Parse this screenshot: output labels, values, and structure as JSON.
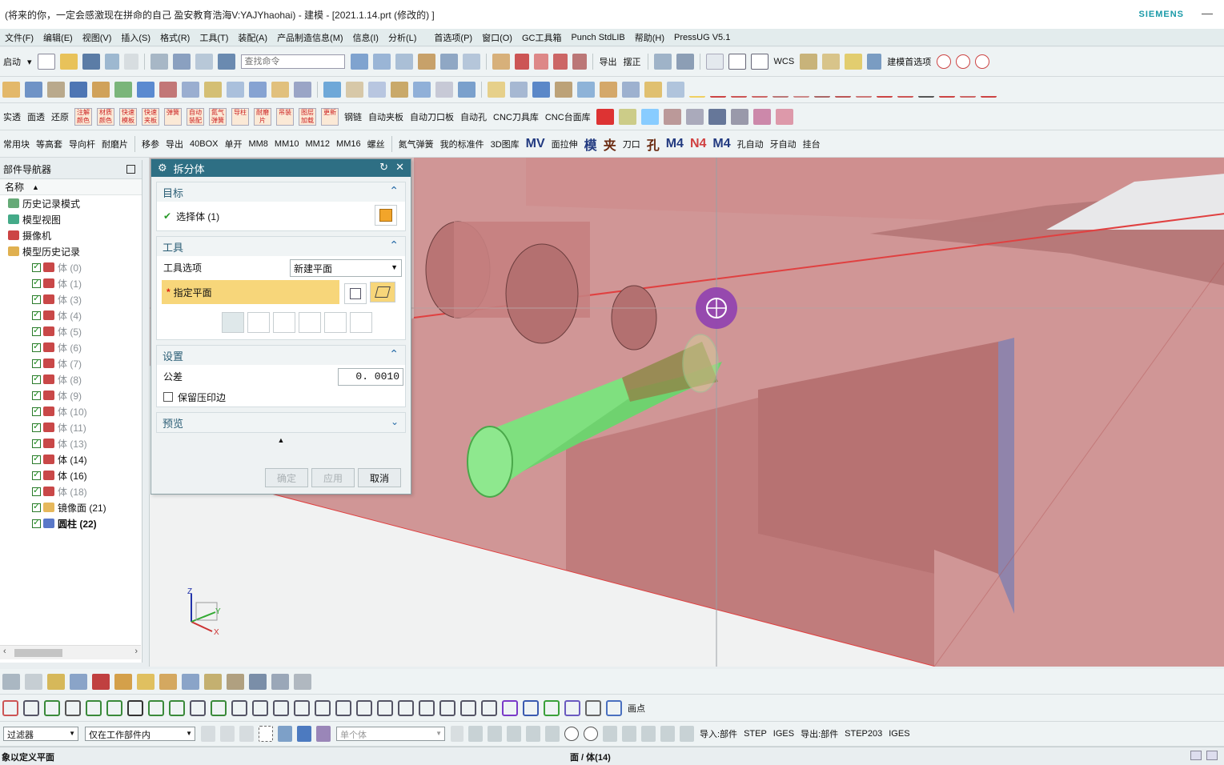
{
  "window": {
    "title": "(将来的你，一定会感激现在拼命的自己 盈安教育浩海V:YAJYhaohai) - 建模 - [2021.1.14.prt  (修改的) ]",
    "brand": "SIEMENS",
    "minimize": "—"
  },
  "menu": [
    "文件(F)",
    "编辑(E)",
    "视图(V)",
    "插入(S)",
    "格式(R)",
    "工具(T)",
    "装配(A)",
    "产品制造信息(M)",
    "信息(I)",
    "分析(L)",
    "首选项(P)",
    "窗口(O)",
    "GC工具箱",
    "Punch StdLIB",
    "帮助(H)",
    "PressUG V5.1"
  ],
  "toolbar1": {
    "start": "启动",
    "search_placeholder": "查找命令",
    "export": "导出",
    "align": "摆正",
    "wcs": "WCS",
    "model_pref": "建模首选项"
  },
  "toolbar3": [
    "实透",
    "面透",
    "还原",
    "注解颜色",
    "材质颜色",
    "快速模板",
    "快速夹板",
    "弹簧",
    "自动装配",
    "氮气弹簧",
    "导柱",
    "耐磨片",
    "吊装",
    "图层加载",
    "更新",
    "钢链",
    "自动夹板",
    "自动刀口板",
    "自动孔",
    "CNC刀具库",
    "CNC台面库"
  ],
  "toolbar4": [
    "常用块",
    "等高套",
    "导向杆",
    "耐磨片",
    "移参",
    "导出",
    "40BOX",
    "单开",
    "MM8",
    "MM10",
    "MM12",
    "MM16",
    "螺丝",
    "氮气弹簧",
    "我的标准件",
    "3D图库",
    "MV",
    "面拉伸",
    "模",
    "夹",
    "刀口",
    "孔",
    "M4",
    "N4",
    "M4",
    "孔自动",
    "牙自动",
    "挂台"
  ],
  "navigator": {
    "title": "部件导航器",
    "column": "名称",
    "items": [
      {
        "label": "历史记录模式",
        "level": 1,
        "style": "normal"
      },
      {
        "label": "模型视图",
        "level": 1,
        "style": "normal"
      },
      {
        "label": "摄像机",
        "level": 1,
        "style": "normal"
      },
      {
        "label": "模型历史记录",
        "level": 1,
        "style": "normal"
      },
      {
        "label": "体 (0)",
        "level": 2,
        "style": "gray"
      },
      {
        "label": "体 (1)",
        "level": 2,
        "style": "gray"
      },
      {
        "label": "体 (3)",
        "level": 2,
        "style": "gray"
      },
      {
        "label": "体 (4)",
        "level": 2,
        "style": "gray"
      },
      {
        "label": "体 (5)",
        "level": 2,
        "style": "gray"
      },
      {
        "label": "体 (6)",
        "level": 2,
        "style": "gray"
      },
      {
        "label": "体 (7)",
        "level": 2,
        "style": "gray"
      },
      {
        "label": "体 (8)",
        "level": 2,
        "style": "gray"
      },
      {
        "label": "体 (9)",
        "level": 2,
        "style": "gray"
      },
      {
        "label": "体 (10)",
        "level": 2,
        "style": "gray"
      },
      {
        "label": "体 (11)",
        "level": 2,
        "style": "gray"
      },
      {
        "label": "体 (13)",
        "level": 2,
        "style": "gray"
      },
      {
        "label": "体 (14)",
        "level": 2,
        "style": "normal"
      },
      {
        "label": "体 (16)",
        "level": 2,
        "style": "normal"
      },
      {
        "label": "体 (18)",
        "level": 2,
        "style": "gray"
      },
      {
        "label": "镜像面 (21)",
        "level": 2,
        "style": "normal"
      },
      {
        "label": "圆柱 (22)",
        "level": 2,
        "style": "bold"
      }
    ]
  },
  "dialog": {
    "title": "拆分体",
    "target": {
      "heading": "目标",
      "select_body": "选择体 (1)"
    },
    "tool": {
      "heading": "工具",
      "option_label": "工具选项",
      "option_value": "新建平面",
      "plane_label": "指定平面"
    },
    "settings": {
      "heading": "设置",
      "tolerance_label": "公差",
      "tolerance_value": "0. 0010",
      "keep_imprint": "保留压印边"
    },
    "preview": {
      "heading": "预览"
    },
    "buttons": {
      "ok": "确定",
      "apply": "应用",
      "cancel": "取消"
    }
  },
  "viewport": {
    "triad": {
      "x": "X",
      "y": "Y",
      "z": "Z"
    }
  },
  "bottom_toolbar": {
    "filter": "过滤器",
    "scope": "仅在工作部件内",
    "single": "单个体",
    "import": "导入:部件",
    "step": "STEP",
    "iges": "IGES",
    "export": "导出:部件",
    "step203": "STEP203",
    "iges2": "IGES",
    "points": "画点"
  },
  "status": {
    "left": "象以定义平面",
    "center": "面 / 体(14)"
  },
  "colors": {
    "accent": "#2e6f84",
    "highlight": "#f7d67a",
    "body_red": "#c98585",
    "cylinder_green": "#7ee27e"
  }
}
